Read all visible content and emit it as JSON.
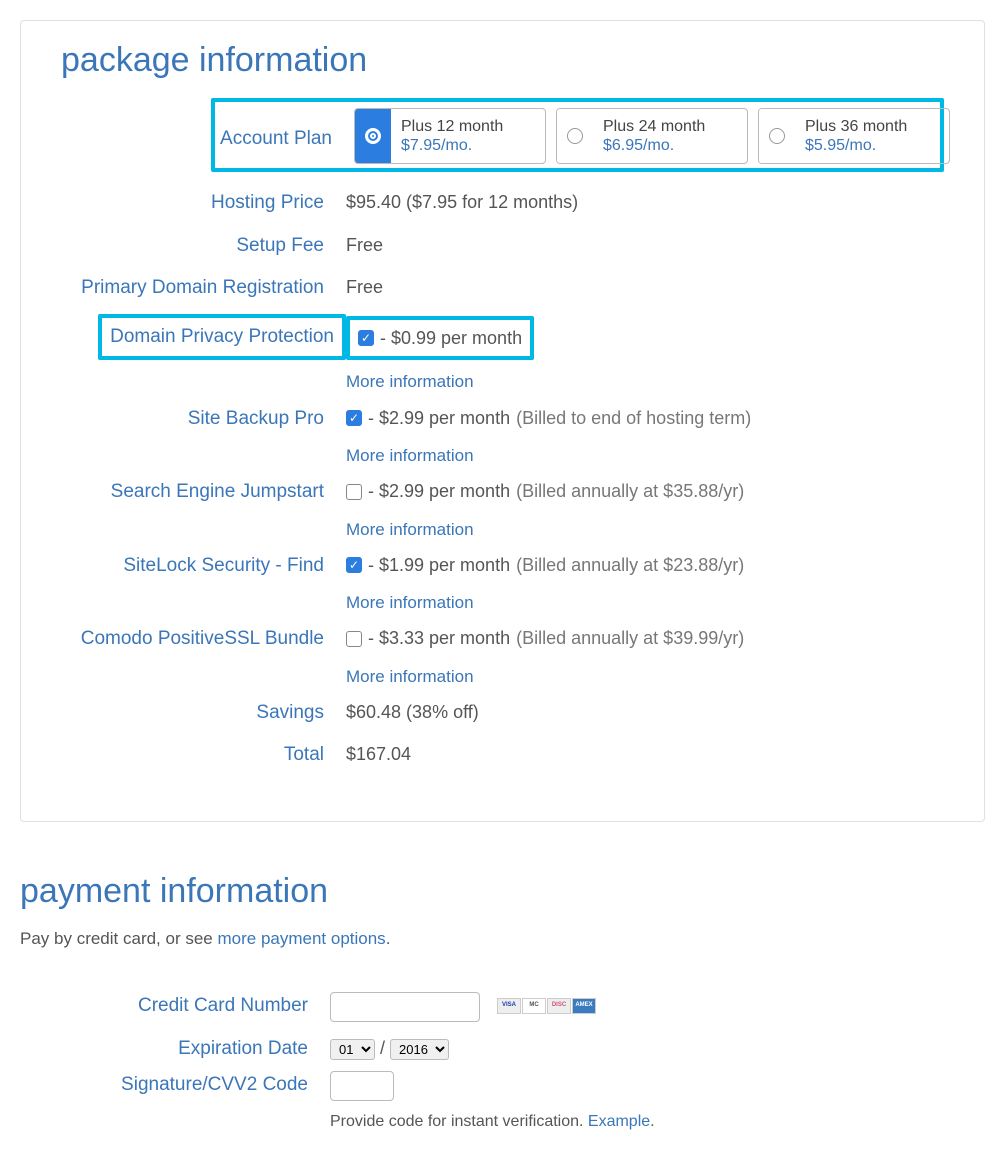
{
  "package": {
    "title": "package information",
    "accountPlanLabel": "Account Plan",
    "plans": [
      {
        "name": "Plus 12 month",
        "price": "$7.95/mo.",
        "selected": true
      },
      {
        "name": "Plus 24 month",
        "price": "$6.95/mo.",
        "selected": false
      },
      {
        "name": "Plus 36 month",
        "price": "$5.95/mo.",
        "selected": false
      }
    ],
    "hostingPriceLabel": "Hosting Price",
    "hostingPriceValue": "$95.40  ($7.95 for 12 months)",
    "setupFeeLabel": "Setup Fee",
    "setupFeeValue": "Free",
    "primaryDomainLabel": "Primary Domain Registration",
    "primaryDomainValue": "Free",
    "addons": {
      "privacy": {
        "label": "Domain Privacy Protection",
        "price": "- $0.99 per month",
        "billing": "",
        "checked": true
      },
      "backup": {
        "label": "Site Backup Pro",
        "price": "- $2.99 per month",
        "billing": "(Billed to end of hosting term)",
        "checked": true
      },
      "jumpstart": {
        "label": "Search Engine Jumpstart",
        "price": "- $2.99 per month",
        "billing": "(Billed annually at $35.88/yr)",
        "checked": false
      },
      "sitelock": {
        "label": "SiteLock Security - Find",
        "price": "- $1.99 per month",
        "billing": "(Billed annually at $23.88/yr)",
        "checked": true
      },
      "ssl": {
        "label": "Comodo PositiveSSL Bundle",
        "price": "- $3.33 per month",
        "billing": "(Billed annually at $39.99/yr)",
        "checked": false
      }
    },
    "moreInfo": "More information",
    "savingsLabel": "Savings",
    "savingsValue": "$60.48 (38% off)",
    "totalLabel": "Total",
    "totalValue": "$167.04"
  },
  "payment": {
    "title": "payment information",
    "introPrefix": "Pay by credit card, or see ",
    "introLink": "more payment options",
    "introSuffix": ".",
    "ccLabel": "Credit Card Number",
    "expLabel": "Expiration Date",
    "expMonth": "01",
    "expYear": "2016",
    "expSep": "/",
    "cvvLabel": "Signature/CVV2 Code",
    "cvvNote": "Provide code for instant verification. ",
    "cvvExample": "Example",
    "cards": [
      "VISA",
      "MC",
      "DISC",
      "AMEX"
    ]
  }
}
